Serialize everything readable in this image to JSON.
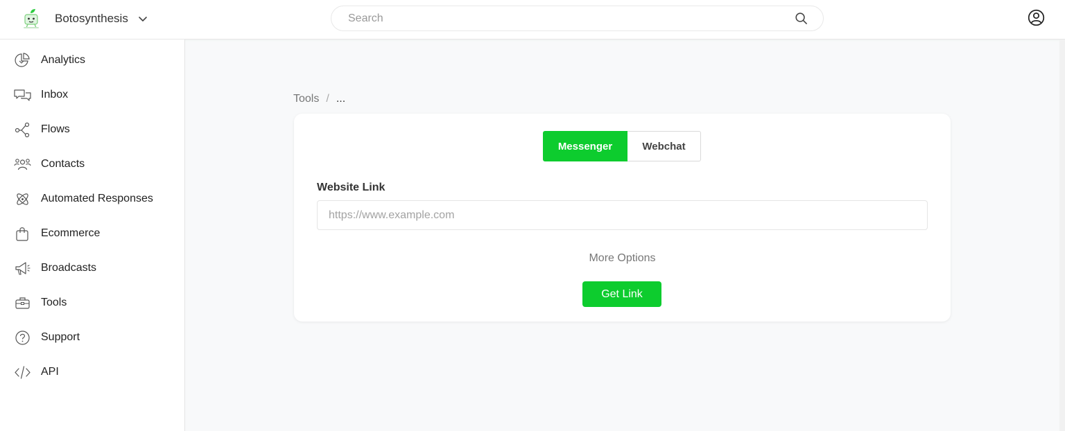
{
  "header": {
    "brand_name": "Botosynthesis",
    "search_placeholder": "Search"
  },
  "sidebar": {
    "items": [
      {
        "label": "Analytics",
        "icon": "analytics-icon"
      },
      {
        "label": "Inbox",
        "icon": "inbox-icon"
      },
      {
        "label": "Flows",
        "icon": "flows-icon"
      },
      {
        "label": "Contacts",
        "icon": "contacts-icon"
      },
      {
        "label": "Automated Responses",
        "icon": "atom-icon"
      },
      {
        "label": "Ecommerce",
        "icon": "shopping-bag-icon"
      },
      {
        "label": "Broadcasts",
        "icon": "megaphone-icon"
      },
      {
        "label": "Tools",
        "icon": "toolbox-icon"
      },
      {
        "label": "Support",
        "icon": "help-circle-icon"
      },
      {
        "label": "API",
        "icon": "code-icon"
      }
    ]
  },
  "breadcrumb": {
    "root": "Tools",
    "separator": "/",
    "current": "..."
  },
  "card": {
    "tabs": [
      {
        "label": "Messenger",
        "active": true
      },
      {
        "label": "Webchat",
        "active": false
      }
    ],
    "field_label": "Website Link",
    "field_placeholder": "https://www.example.com",
    "field_value": "",
    "more_options": "More Options",
    "submit_label": "Get Link"
  },
  "colors": {
    "accent": "#0dcc2e",
    "background": "#f8f9fa",
    "surface": "#ffffff"
  }
}
